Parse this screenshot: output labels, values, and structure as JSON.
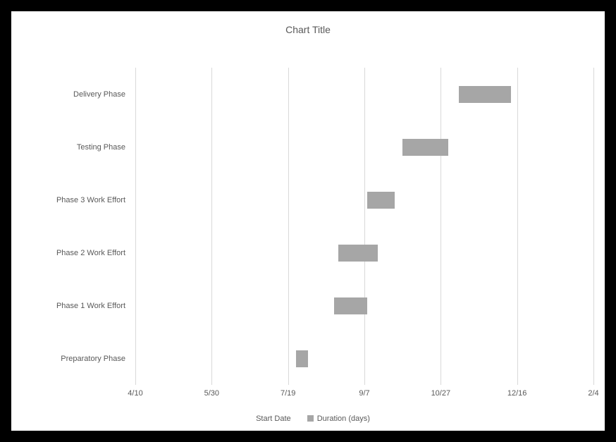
{
  "chart_data": {
    "type": "bar",
    "orientation": "horizontal",
    "stacked": true,
    "title": "Chart Title",
    "x_ticks": [
      "4/10",
      "5/30",
      "7/19",
      "9/7",
      "10/27",
      "12/16",
      "2/4"
    ],
    "x_tick_serials": [
      42835,
      42885,
      42935,
      42985,
      43035,
      43085,
      43135
    ],
    "x_range": [
      42835,
      43135
    ],
    "categories_top_to_bottom": [
      "Delivery Phase",
      "Testing Phase",
      "Phase 3 Work Effort",
      "Phase 2 Work Effort",
      "Phase 1 Work Effort",
      "Preparatory Phase"
    ],
    "series": [
      {
        "name": "Start Date",
        "role": "offset_hidden",
        "values_top_to_bottom": [
          43047,
          43010,
          42987,
          42968,
          42965,
          42940
        ]
      },
      {
        "name": "Duration (days)",
        "role": "visible",
        "values_top_to_bottom": [
          34,
          30,
          18,
          26,
          22,
          8
        ]
      }
    ],
    "legend": [
      "Start Date",
      "Duration (days)"
    ]
  }
}
